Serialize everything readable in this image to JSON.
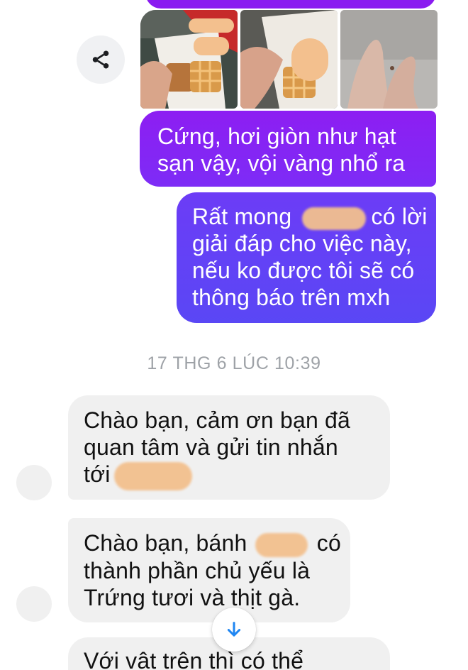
{
  "icons": {
    "share": "share-icon",
    "scroll_down": "arrow-down-icon"
  },
  "colors": {
    "outgoing_bubble": "#8a1bf0",
    "outgoing_bubble_2": "#6040f5",
    "incoming_bubble": "#f0f0f0",
    "timestamp_text": "#9ea2a7",
    "scroll_arrow": "#1f86f2",
    "redaction": "#f3c08e"
  },
  "messages": {
    "outgoing_1": {
      "line1": "Cứng, hơi giòn như hạt",
      "line2": "sạn vậy, vội vàng nhổ ra"
    },
    "outgoing_2": {
      "line1_a": "Rất mong",
      "line1_b": "có lời",
      "line2": "giải đáp cho việc này,",
      "line3": "nếu ko được tôi sẽ có",
      "line4": "thông báo trên mxh"
    },
    "timestamp": "17 THG 6 LÚC 10:39",
    "incoming_1": {
      "line1": "Chào bạn, cảm ơn bạn đã",
      "line2": "quan tâm và gửi tin nhắn",
      "line3_a": "tới"
    },
    "incoming_2": {
      "line1_a": "Chào bạn, bánh",
      "line1_b": "có",
      "line2": "thành phần chủ yếu là",
      "line3": "Trứng tươi và thịt gà."
    },
    "incoming_3": {
      "line1": "Với vật trên thì có thể"
    }
  }
}
